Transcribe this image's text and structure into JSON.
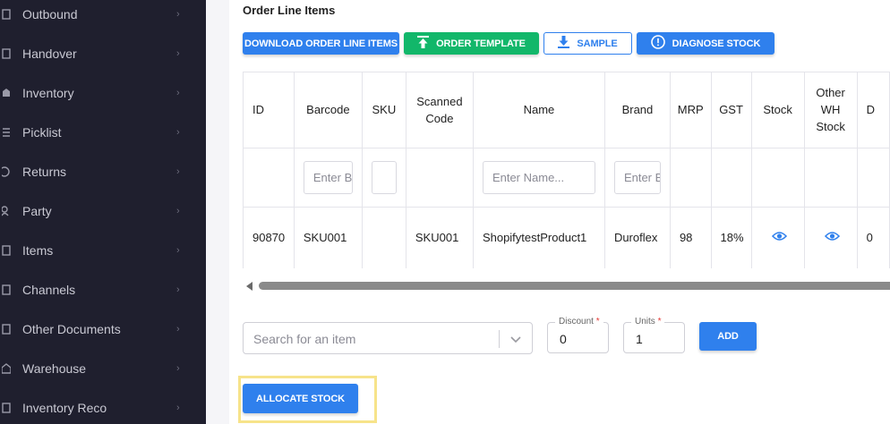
{
  "sidebar": {
    "items": [
      {
        "label": "Outbound",
        "icon": "outbound-icon"
      },
      {
        "label": "Handover",
        "icon": "handover-icon"
      },
      {
        "label": "Inventory",
        "icon": "inventory-icon"
      },
      {
        "label": "Picklist",
        "icon": "picklist-icon"
      },
      {
        "label": "Returns",
        "icon": "returns-icon"
      },
      {
        "label": "Party",
        "icon": "party-icon"
      },
      {
        "label": "Items",
        "icon": "items-icon"
      },
      {
        "label": "Channels",
        "icon": "channels-icon"
      },
      {
        "label": "Other Documents",
        "icon": "documents-icon"
      },
      {
        "label": "Warehouse",
        "icon": "warehouse-icon"
      },
      {
        "label": "Inventory Reco",
        "icon": "inventory-reco-icon"
      }
    ]
  },
  "section": {
    "title": "Order Line Items"
  },
  "toolbar": {
    "download_label": "DOWNLOAD ORDER LINE ITEMS",
    "template_label": "ORDER TEMPLATE",
    "sample_label": "SAMPLE",
    "diagnose_label": "DIAGNOSE STOCK"
  },
  "table": {
    "headers": [
      "ID",
      "Barcode",
      "SKU",
      "Scanned Code",
      "Name",
      "Brand",
      "MRP",
      "GST",
      "Stock",
      "Other WH Stock",
      "D"
    ],
    "filters": {
      "barcode_placeholder": "Enter Barcode",
      "sku_placeholder": "",
      "name_placeholder": "Enter Name...",
      "brand_placeholder": "Enter Brand"
    },
    "rows": [
      {
        "id": "90870",
        "barcode": "SKU001",
        "sku": "",
        "scanned_code": "SKU001",
        "name": "ShopifytestProduct1",
        "brand": "Duroflex",
        "mrp": "98",
        "gst": "18%",
        "d": "0"
      }
    ]
  },
  "add_item": {
    "search_placeholder": "Search for an item",
    "discount_label": "Discount",
    "discount_value": "0",
    "units_label": "Units",
    "units_value": "1",
    "required_mark": "*",
    "add_label": "ADD"
  },
  "allocate": {
    "label": "ALLOCATE STOCK"
  },
  "colors": {
    "primary": "#2f80ed",
    "success": "#12b76a",
    "sidebar_bg": "#1f1f2e",
    "highlight": "#f7e38a"
  }
}
